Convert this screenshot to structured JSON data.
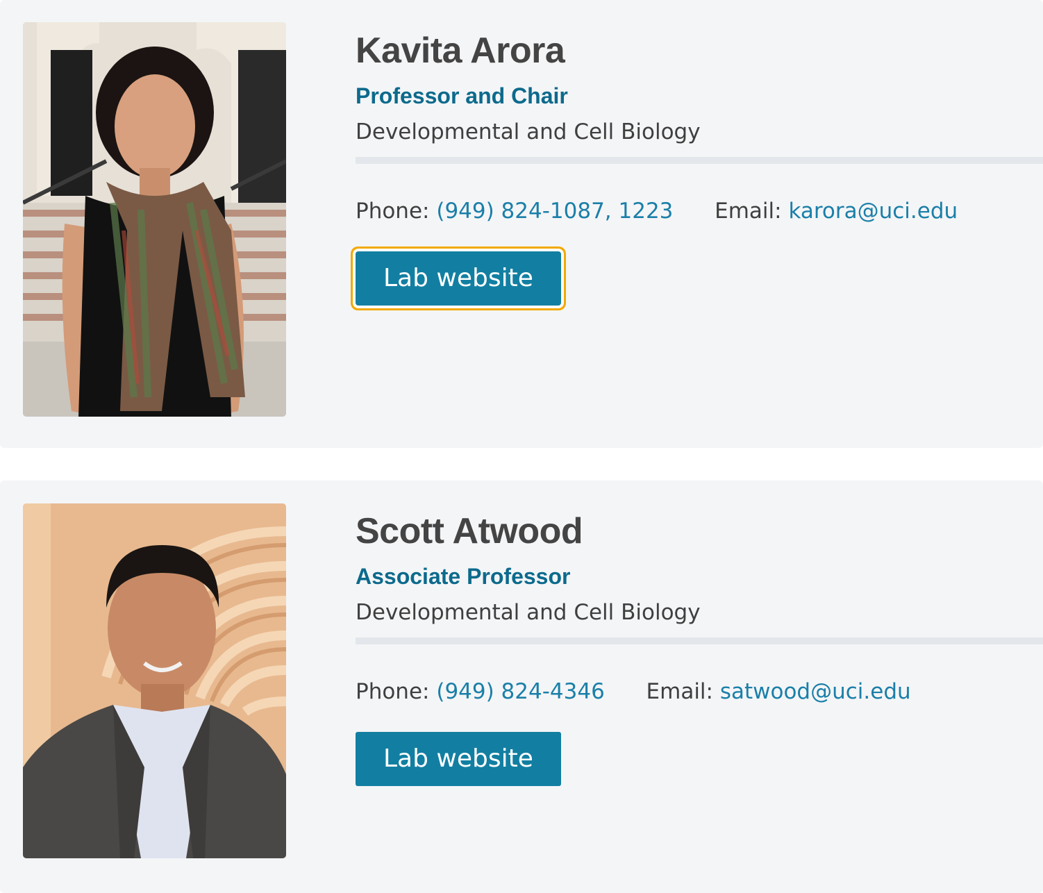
{
  "faculty": [
    {
      "name": "Kavita Arora",
      "title": "Professor and Chair",
      "department": "Developmental and Cell Biology",
      "phone_label": "Phone:",
      "phone": "(949) 824-1087, 1223",
      "email_label": "Email:",
      "email": "karora@uci.edu",
      "button_label": "Lab website"
    },
    {
      "name": "Scott Atwood",
      "title": "Associate Professor",
      "department": "Developmental and Cell Biology",
      "phone_label": "Phone:",
      "phone": "(949) 824-4346",
      "email_label": "Email:",
      "email": "satwood@uci.edu",
      "button_label": "Lab website"
    }
  ],
  "colors": {
    "card_background": "#f4f5f7",
    "title": "#0c6a8c",
    "link": "#1a7fa8",
    "button": "#127fa2",
    "focus_ring": "#f2a900"
  }
}
